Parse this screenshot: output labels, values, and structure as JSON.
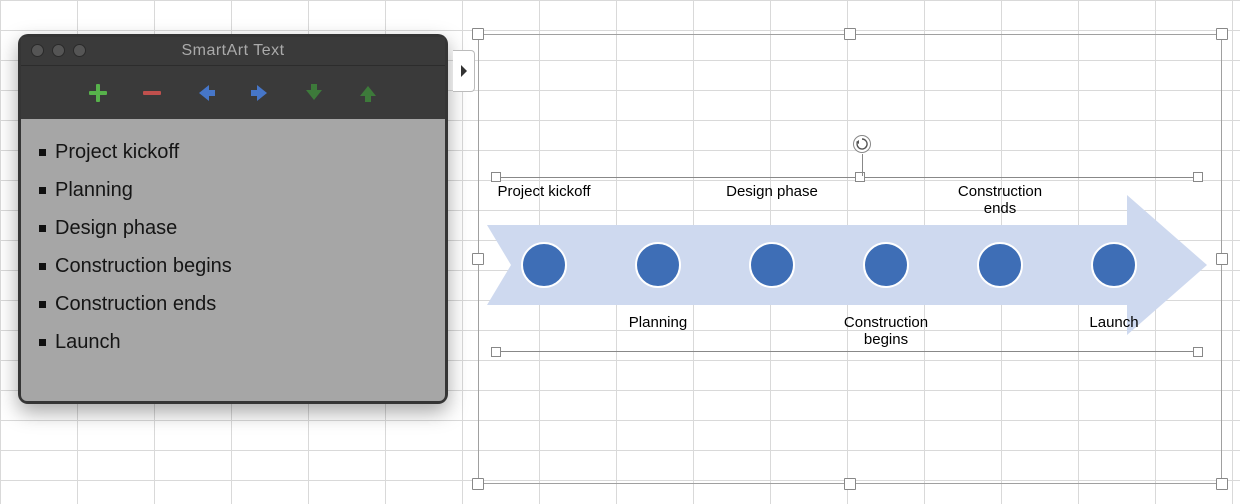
{
  "panel": {
    "title": "SmartArt Text",
    "toolbar": {
      "add": "add-item",
      "remove": "remove-item",
      "promote": "move-left",
      "demote": "move-right",
      "down": "move-down",
      "up": "move-up"
    },
    "items": [
      "Project kickoff",
      "Planning",
      "Design phase",
      "Construction begins",
      "Construction ends",
      "Launch"
    ]
  },
  "diagram": {
    "milestones": [
      {
        "label": "Project kickoff",
        "pos": "top"
      },
      {
        "label": "Planning",
        "pos": "bottom"
      },
      {
        "label": "Design phase",
        "pos": "top"
      },
      {
        "label": "Construction begins",
        "pos": "bottom"
      },
      {
        "label": "Construction ends",
        "pos": "top"
      },
      {
        "label": "Launch",
        "pos": "bottom"
      }
    ],
    "colors": {
      "arrow_fill": "#ced9ef",
      "dot_fill": "#3e6eb6"
    }
  }
}
